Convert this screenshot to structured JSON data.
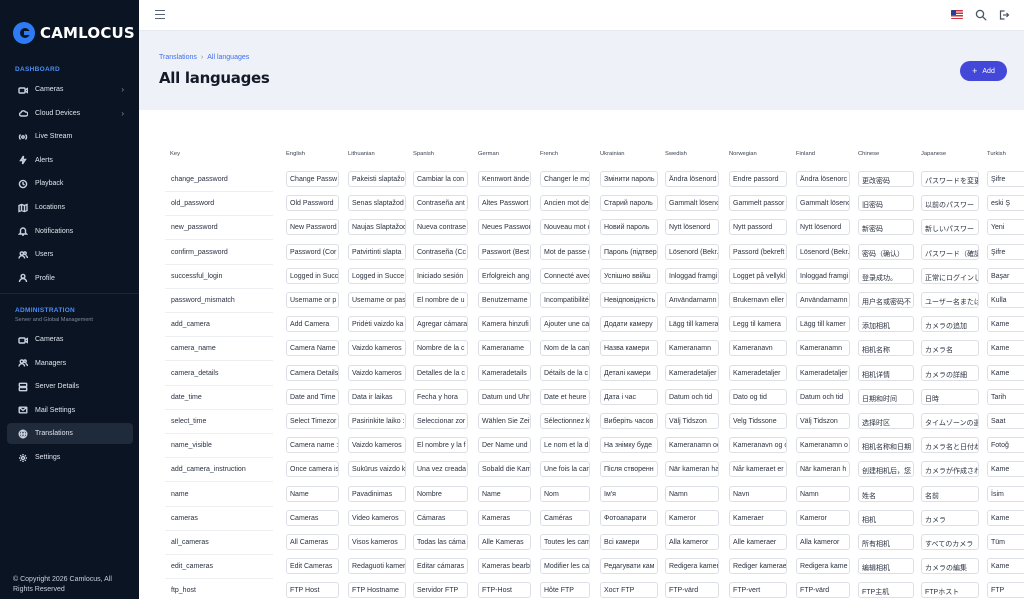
{
  "brand": {
    "name": "CAMLOCUS"
  },
  "sidebar": {
    "dashboard_title": "DASHBOARD",
    "dashboard_items": [
      {
        "label": "Cameras",
        "icon": "video-icon",
        "has_chevron": true
      },
      {
        "label": "Cloud Devices",
        "icon": "cloud-icon",
        "has_chevron": true
      },
      {
        "label": "Live Stream",
        "icon": "live-icon",
        "has_chevron": false
      },
      {
        "label": "Alerts",
        "icon": "bolt-icon",
        "has_chevron": false
      },
      {
        "label": "Playback",
        "icon": "history-icon",
        "has_chevron": false
      },
      {
        "label": "Locations",
        "icon": "map-icon",
        "has_chevron": false
      },
      {
        "label": "Notifications",
        "icon": "bell-icon",
        "has_chevron": false
      },
      {
        "label": "Users",
        "icon": "users-icon",
        "has_chevron": false
      },
      {
        "label": "Profile",
        "icon": "user-icon",
        "has_chevron": false
      }
    ],
    "admin_title": "ADMINISTRATION",
    "admin_subtitle": "Server and Global Management",
    "admin_items": [
      {
        "label": "Cameras",
        "icon": "video-icon"
      },
      {
        "label": "Managers",
        "icon": "users-icon"
      },
      {
        "label": "Server Details",
        "icon": "server-icon"
      },
      {
        "label": "Mail Settings",
        "icon": "mail-icon"
      },
      {
        "label": "Translations",
        "icon": "globe-icon",
        "active": true
      },
      {
        "label": "Settings",
        "icon": "gear-icon"
      }
    ],
    "copyright": "© Copyright 2026 Camlocus, All Rights Reserved"
  },
  "header": {
    "language_flag": "us-flag-icon",
    "accent_color": "#4348d9"
  },
  "breadcrumb": {
    "parent": "Translations",
    "current": "All languages"
  },
  "page": {
    "title": "All languages",
    "add_button": "Add"
  },
  "table": {
    "columns": [
      "Key",
      "English",
      "Lithuanian",
      "Spanish",
      "German",
      "French",
      "Ukrainian",
      "Swedish",
      "Norwegian",
      "Finland",
      "Chinese",
      "Japanese",
      "Turkish"
    ],
    "rows": [
      {
        "key": "change_password",
        "values": [
          "Change Passw",
          "Pakeisti slaptažo",
          "Cambiar la con",
          "Kennwort ände",
          "Changer le mo",
          "Змінити пароль",
          "Ändra lösenord",
          "Endre passord",
          "Ändra lösenorc",
          "更改密码",
          "パスワードを変更",
          "Şifre"
        ]
      },
      {
        "key": "old_password",
        "values": [
          "Old Password",
          "Senas slaptažod",
          "Contraseña ant",
          "Altes Passwort",
          "Ancien mot de",
          "Старий пароль",
          "Gammalt lösenc",
          "Gammelt passor",
          "Gammalt lösenc",
          "旧密码",
          "以前のパスワー",
          "eski Ş"
        ]
      },
      {
        "key": "new_password",
        "values": [
          "New Password",
          "Naujas Slaptažod",
          "Nueva contrase",
          "Neues Passwor",
          "Nouveau mot c",
          "Новий пароль",
          "Nytt lösenord",
          "Nytt passord",
          "Nytt lösenord",
          "新密码",
          "新しいパスワー",
          "Yeni"
        ]
      },
      {
        "key": "confirm_password",
        "values": [
          "Password (Cor",
          "Patvirtinti slapta",
          "Contraseña (Cc",
          "Passwort (Best",
          "Mot de passe (",
          "Пароль (підтвер",
          "Lösenord (Bekr.",
          "Passord (bekreft",
          "Lösenord (Bekr.",
          "密码（确认）",
          "パスワード（確認",
          "Şifre"
        ]
      },
      {
        "key": "successful_login",
        "values": [
          "Logged in Succ",
          "Logged in Succe",
          "Iniciado sesión",
          "Erfolgreich ang",
          "Connecté avec",
          "Успішно ввійш",
          "Inloggad framgi",
          "Logget på vellykl",
          "Inloggad framgi",
          "登录成功。",
          "正常にログインし",
          "Başar"
        ]
      },
      {
        "key": "password_mismatch",
        "values": [
          "Username or p",
          "Username or pas",
          "El nombre de u",
          "Benutzername",
          "Incompatibilité",
          "Невідповідність",
          "Användarnamn",
          "Brukernavn eller",
          "Användarnamn",
          "用户名或密码不",
          "ユーザー名または",
          "Kulla"
        ]
      },
      {
        "key": "add_camera",
        "values": [
          "Add Camera",
          "Pridėti vaizdo ka",
          "Agregar cámara",
          "Kamera hinzufi",
          "Ajouter une ca",
          "Додати камеру",
          "Lägg till kamera",
          "Legg til kamera",
          "Lägg till kamer",
          "添加相机",
          "カメラの追加",
          "Kame"
        ]
      },
      {
        "key": "camera_name",
        "values": [
          "Camera Name",
          "Vaizdo kameros",
          "Nombre de la c",
          "Kameraname",
          "Nom de la cam",
          "Назва камери",
          "Kameranamn",
          "Kameranavn",
          "Kameranamn",
          "相机名称",
          "カメラ名",
          "Kame"
        ]
      },
      {
        "key": "camera_details",
        "values": [
          "Camera Details",
          "Vaizdo kameros",
          "Detalles de la c",
          "Kameradetails",
          "Détails de la c",
          "Деталі камери",
          "Kameradetaljer",
          "Kameradetaljer",
          "Kameradetaljer",
          "相机详情",
          "カメラの詳細",
          "Kame"
        ]
      },
      {
        "key": "date_time",
        "values": [
          "Date and Time",
          "Data ir laikas",
          "Fecha y hora",
          "Datum und Uhr",
          "Date et heure",
          "Дата і час",
          "Datum och tid",
          "Dato og tid",
          "Datum och tid",
          "日期和时间",
          "日時",
          "Tarih"
        ]
      },
      {
        "key": "select_time",
        "values": [
          "Select Timezor",
          "Pasirinkite laiko :",
          "Seleccionar zor",
          "Wählen Sie Zeit",
          "Sélectionnez k",
          "Виберіть часов",
          "Välj Tidszon",
          "Velg Tidssone",
          "Välj Tidszon",
          "选择时区",
          "タイムゾーンの選",
          "Saat"
        ]
      },
      {
        "key": "name_visible",
        "values": [
          "Camera name :",
          "Vaizdo kameros",
          "El nombre y la f",
          "Der Name und",
          "Le nom et la d",
          "На знімку буде",
          "Kameranamn oc",
          "Kameranavn og c",
          "Kameranamn o",
          "相机名称和日期",
          "カメラ名と日付ね",
          "Fotoğ"
        ]
      },
      {
        "key": "add_camera_instruction",
        "values": [
          "Once camera is",
          "Sukūrus vaizdo k",
          "Una vez creada",
          "Sobald die Kam",
          "Une fois la can",
          "Після створенн",
          "När kameran ha",
          "Når kameraet er",
          "När kameran h",
          "创建相机后，您",
          "カメラが作成され",
          "Kame"
        ]
      },
      {
        "key": "name",
        "values": [
          "Name",
          "Pavadinimas",
          "Nombre",
          "Name",
          "Nom",
          "Ім'я",
          "Namn",
          "Navn",
          "Namn",
          "姓名",
          "名前",
          "İsim"
        ]
      },
      {
        "key": "cameras",
        "values": [
          "Cameras",
          "Video kameros",
          "Cámaras",
          "Kameras",
          "Caméras",
          "Фотоапарати",
          "Kameror",
          "Kameraer",
          "Kameror",
          "相机",
          "カメラ",
          "Kame"
        ]
      },
      {
        "key": "all_cameras",
        "values": [
          "All Cameras",
          "Visos kameros",
          "Todas las cáma",
          "Alle Kameras",
          "Toutes les cam",
          "Всі камери",
          "Alla kameror",
          "Alle kameraer",
          "Alla kameror",
          "所有相机",
          "すべてのカメラ",
          "Tüm"
        ]
      },
      {
        "key": "edit_cameras",
        "values": [
          "Edit Cameras",
          "Redaguoti kamer",
          "Editar cámaras",
          "Kameras bearb",
          "Modifier les ca",
          "Редагувати кам",
          "Redigera kamer",
          "Rediger kamerae",
          "Redigera kame",
          "编辑相机",
          "カメラの編集",
          "Kame"
        ]
      },
      {
        "key": "ftp_host",
        "values": [
          "FTP Host",
          "FTP Hostname",
          "Servidor FTP",
          "FTP-Host",
          "Hôte FTP",
          "Хост FTP",
          "FTP-värd",
          "FTP-vert",
          "FTP-värd",
          "FTP主机",
          "FTPホスト",
          "FTP"
        ]
      }
    ]
  }
}
